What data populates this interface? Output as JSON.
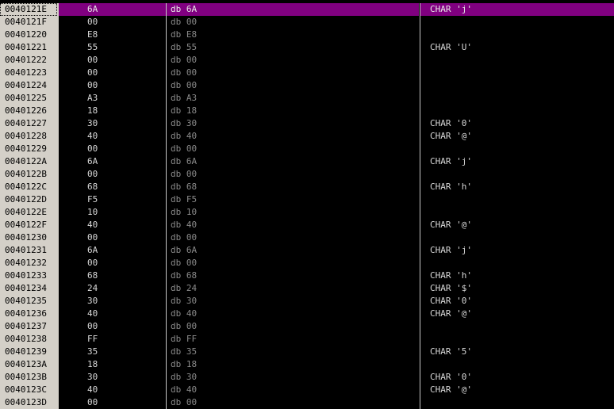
{
  "colors": {
    "background": "#000000",
    "selection": "#800080",
    "address_bg": "#d4d0c8",
    "text": "#d8d8d8",
    "command_text": "#8a8a8a"
  },
  "rows": [
    {
      "address": "0040121E",
      "hex": "6A",
      "command": "db 6A",
      "comment": "CHAR 'j'",
      "selected": true
    },
    {
      "address": "0040121F",
      "hex": "00",
      "command": "db 00",
      "comment": ""
    },
    {
      "address": "00401220",
      "hex": "E8",
      "command": "db E8",
      "comment": ""
    },
    {
      "address": "00401221",
      "hex": "55",
      "command": "db 55",
      "comment": "CHAR 'U'"
    },
    {
      "address": "00401222",
      "hex": "00",
      "command": "db 00",
      "comment": ""
    },
    {
      "address": "00401223",
      "hex": "00",
      "command": "db 00",
      "comment": ""
    },
    {
      "address": "00401224",
      "hex": "00",
      "command": "db 00",
      "comment": ""
    },
    {
      "address": "00401225",
      "hex": "A3",
      "command": "db A3",
      "comment": ""
    },
    {
      "address": "00401226",
      "hex": "18",
      "command": "db 18",
      "comment": ""
    },
    {
      "address": "00401227",
      "hex": "30",
      "command": "db 30",
      "comment": "CHAR '0'"
    },
    {
      "address": "00401228",
      "hex": "40",
      "command": "db 40",
      "comment": "CHAR '@'"
    },
    {
      "address": "00401229",
      "hex": "00",
      "command": "db 00",
      "comment": ""
    },
    {
      "address": "0040122A",
      "hex": "6A",
      "command": "db 6A",
      "comment": "CHAR 'j'"
    },
    {
      "address": "0040122B",
      "hex": "00",
      "command": "db 00",
      "comment": ""
    },
    {
      "address": "0040122C",
      "hex": "68",
      "command": "db 68",
      "comment": "CHAR 'h'"
    },
    {
      "address": "0040122D",
      "hex": "F5",
      "command": "db F5",
      "comment": ""
    },
    {
      "address": "0040122E",
      "hex": "10",
      "command": "db 10",
      "comment": ""
    },
    {
      "address": "0040122F",
      "hex": "40",
      "command": "db 40",
      "comment": "CHAR '@'"
    },
    {
      "address": "00401230",
      "hex": "00",
      "command": "db 00",
      "comment": ""
    },
    {
      "address": "00401231",
      "hex": "6A",
      "command": "db 6A",
      "comment": "CHAR 'j'"
    },
    {
      "address": "00401232",
      "hex": "00",
      "command": "db 00",
      "comment": ""
    },
    {
      "address": "00401233",
      "hex": "68",
      "command": "db 68",
      "comment": "CHAR 'h'"
    },
    {
      "address": "00401234",
      "hex": "24",
      "command": "db 24",
      "comment": "CHAR '$'"
    },
    {
      "address": "00401235",
      "hex": "30",
      "command": "db 30",
      "comment": "CHAR '0'"
    },
    {
      "address": "00401236",
      "hex": "40",
      "command": "db 40",
      "comment": "CHAR '@'"
    },
    {
      "address": "00401237",
      "hex": "00",
      "command": "db 00",
      "comment": ""
    },
    {
      "address": "00401238",
      "hex": "FF",
      "command": "db FF",
      "comment": ""
    },
    {
      "address": "00401239",
      "hex": "35",
      "command": "db 35",
      "comment": "CHAR '5'"
    },
    {
      "address": "0040123A",
      "hex": "18",
      "command": "db 18",
      "comment": ""
    },
    {
      "address": "0040123B",
      "hex": "30",
      "command": "db 30",
      "comment": "CHAR '0'"
    },
    {
      "address": "0040123C",
      "hex": "40",
      "command": "db 40",
      "comment": "CHAR '@'"
    },
    {
      "address": "0040123D",
      "hex": "00",
      "command": "db 00",
      "comment": ""
    }
  ]
}
